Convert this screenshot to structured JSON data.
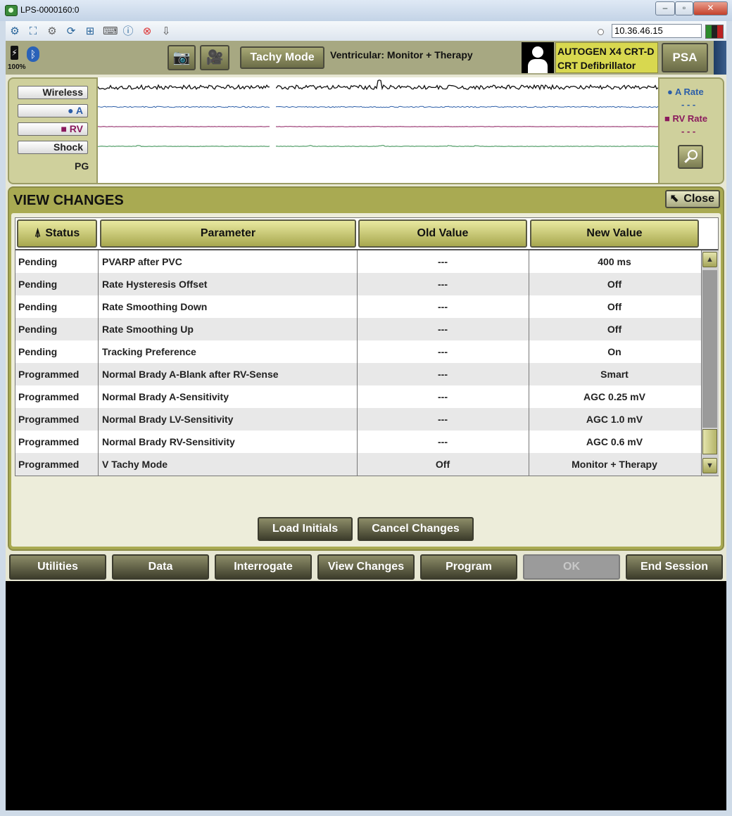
{
  "window": {
    "title": "LPS-0000160:0",
    "minimize": "–",
    "maximize": "▫",
    "close": "✕"
  },
  "toolbar": {
    "ip_address": "10.36.46.15"
  },
  "header": {
    "battery_level": "100%",
    "tachy_mode_label": "Tachy Mode",
    "tachy_status": "Ventricular: Monitor + Therapy",
    "device_name": "AUTOGEN X4 CRT-D",
    "device_type": "CRT Defibrillator",
    "psa_label": "PSA"
  },
  "egm": {
    "wireless_label": "Wireless",
    "a_label": "● A",
    "rv_label": "■ RV",
    "shock_label": "Shock",
    "pg_label": "PG",
    "a_rate_label": "● A Rate",
    "a_rate_value": "- - -",
    "rv_rate_label": "■ RV Rate",
    "rv_rate_value": "- - -"
  },
  "view_changes": {
    "title": "VIEW CHANGES",
    "close_label": "Close",
    "columns": [
      "Status",
      "Parameter",
      "Old Value",
      "New Value"
    ],
    "rows": [
      {
        "status": "Pending",
        "parameter": "PVARP after PVC",
        "old": "---",
        "new": "400  ms"
      },
      {
        "status": "Pending",
        "parameter": "Rate Hysteresis Offset",
        "old": "---",
        "new": "Off"
      },
      {
        "status": "Pending",
        "parameter": "Rate Smoothing Down",
        "old": "---",
        "new": "Off"
      },
      {
        "status": "Pending",
        "parameter": "Rate Smoothing Up",
        "old": "---",
        "new": "Off"
      },
      {
        "status": "Pending",
        "parameter": "Tracking Preference",
        "old": "---",
        "new": "On"
      },
      {
        "status": "Programmed",
        "parameter": "Normal Brady A-Blank after RV-Sense",
        "old": "---",
        "new": "Smart"
      },
      {
        "status": "Programmed",
        "parameter": "Normal Brady A-Sensitivity",
        "old": "---",
        "new": "AGC 0.25  mV"
      },
      {
        "status": "Programmed",
        "parameter": "Normal Brady LV-Sensitivity",
        "old": "---",
        "new": "AGC 1.0  mV"
      },
      {
        "status": "Programmed",
        "parameter": "Normal Brady RV-Sensitivity",
        "old": "---",
        "new": "AGC 0.6  mV"
      },
      {
        "status": "Programmed",
        "parameter": "V Tachy Mode",
        "old": "Off",
        "new": "Monitor + Therapy"
      }
    ],
    "load_initials_label": "Load Initials",
    "cancel_changes_label": "Cancel Changes"
  },
  "nav": {
    "utilities": "Utilities",
    "data": "Data",
    "interrogate": "Interrogate",
    "view_changes": "View Changes",
    "program": "Program",
    "ok": "OK",
    "end_session": "End Session"
  },
  "colors": {
    "a_channel": "#2c5ea8",
    "rv_channel": "#8a1a5d",
    "shock_channel": "#2f8a4a",
    "panel_olive": "#a9aa52"
  }
}
